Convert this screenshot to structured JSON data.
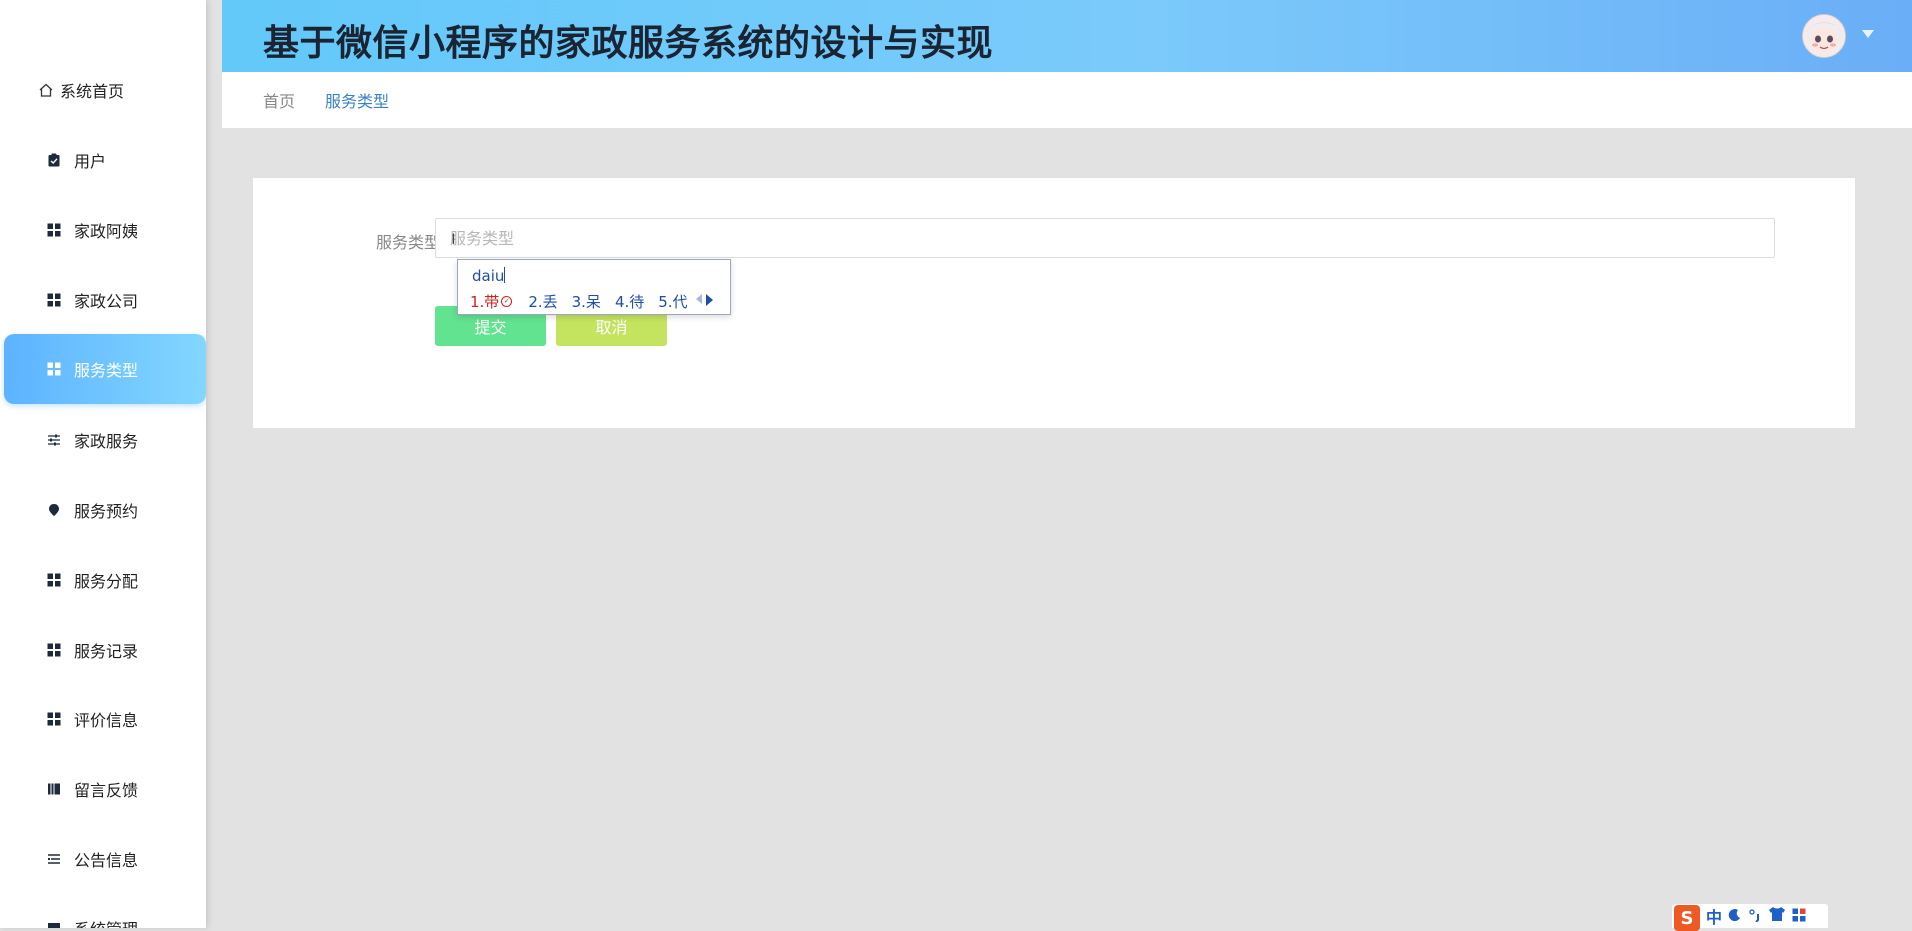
{
  "header": {
    "title": "基于微信小程序的家政服务系统的设计与实现"
  },
  "sidebar": {
    "items": [
      {
        "label": "系统首页",
        "icon": "home-icon"
      },
      {
        "label": "用户",
        "icon": "clipboard-icon"
      },
      {
        "label": "家政阿姨",
        "icon": "grid-icon"
      },
      {
        "label": "家政公司",
        "icon": "grid-icon"
      },
      {
        "label": "服务类型",
        "icon": "grid-icon",
        "active": true
      },
      {
        "label": "家政服务",
        "icon": "sliders-icon"
      },
      {
        "label": "服务预约",
        "icon": "pin-icon"
      },
      {
        "label": "服务分配",
        "icon": "grid-icon"
      },
      {
        "label": "服务记录",
        "icon": "grid-icon"
      },
      {
        "label": "评价信息",
        "icon": "grid-icon"
      },
      {
        "label": "留言反馈",
        "icon": "book-icon"
      },
      {
        "label": "公告信息",
        "icon": "list-icon"
      },
      {
        "label": "系统管理",
        "icon": "gear-icon"
      }
    ]
  },
  "breadcrumb": {
    "home": "首页",
    "current": "服务类型"
  },
  "form": {
    "label": "服务类型",
    "placeholder": "服务类型",
    "value": "",
    "submit_label": "提交",
    "cancel_label": "取消"
  },
  "ime": {
    "pinyin": "daiu",
    "candidates": [
      "1.带",
      "2.丢",
      "3.呆",
      "4.待",
      "5.代"
    ]
  },
  "ime_toolbar": {
    "logo": "S",
    "mode": "中"
  },
  "colors": {
    "header_gradient_start": "#62c9f9",
    "header_gradient_end": "#6aaef7",
    "active_item": "#5db3ff",
    "submit_button": "#62e38f",
    "cancel_button": "#c4e35e",
    "breadcrumb_current": "#3b82c4"
  }
}
